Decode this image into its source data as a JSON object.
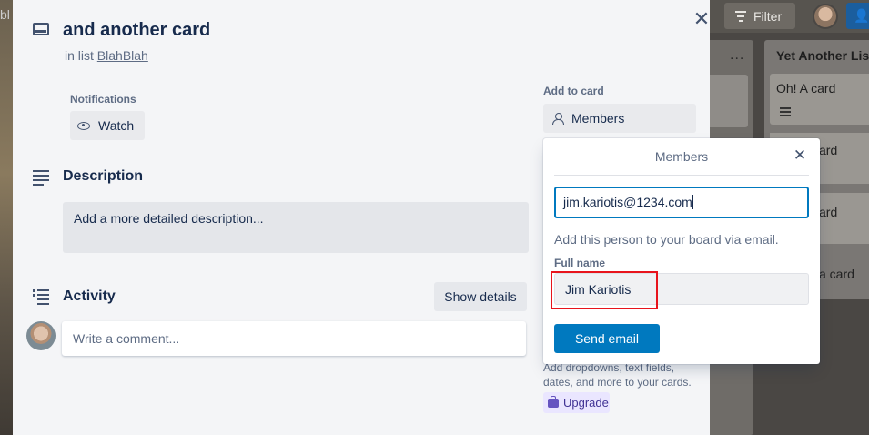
{
  "background": {
    "filter_label": "Filter",
    "list2_title": "Yet Another List",
    "list2_card1": "Oh! A card",
    "list2_card2_fragment": "ard",
    "list2_card3_fragment": "ard",
    "add_card_fragment": "a card",
    "left_fragment": "bl",
    "list1_menu": "..."
  },
  "card": {
    "title": "and another card",
    "in_list_prefix": "in list",
    "list_name": "BlahBlah",
    "close_icon": "close-icon"
  },
  "notifications": {
    "label": "Notifications",
    "watch_label": "Watch"
  },
  "description": {
    "title": "Description",
    "placeholder": "Add a more detailed description..."
  },
  "activity": {
    "title": "Activity",
    "show_details": "Show details",
    "comment_placeholder": "Write a comment..."
  },
  "sidebar": {
    "add_to_card": "Add to card",
    "members_label": "Members",
    "powerups_text": "Add dropdowns, text fields, dates, and more to your cards.",
    "upgrade_label": "Upgrade"
  },
  "members_popover": {
    "title": "Members",
    "email_value": "jim.kariotis@1234.com",
    "hint": "Add this person to your board via email.",
    "full_name_label": "Full name",
    "full_name_value": "Jim Kariotis",
    "send_button": "Send email"
  },
  "colors": {
    "primary": "#0079bf",
    "highlight": "#e8141c",
    "upgrade_bg": "#eae6ff"
  }
}
